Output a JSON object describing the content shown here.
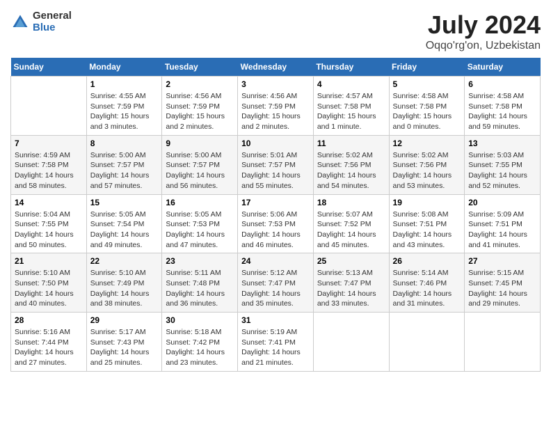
{
  "logo": {
    "general": "General",
    "blue": "Blue"
  },
  "title": "July 2024",
  "location": "Oqqo'rg'on, Uzbekistan",
  "days_of_week": [
    "Sunday",
    "Monday",
    "Tuesday",
    "Wednesday",
    "Thursday",
    "Friday",
    "Saturday"
  ],
  "weeks": [
    [
      {
        "day": "",
        "info": ""
      },
      {
        "day": "1",
        "sunrise": "Sunrise: 4:55 AM",
        "sunset": "Sunset: 7:59 PM",
        "daylight": "Daylight: 15 hours and 3 minutes."
      },
      {
        "day": "2",
        "sunrise": "Sunrise: 4:56 AM",
        "sunset": "Sunset: 7:59 PM",
        "daylight": "Daylight: 15 hours and 2 minutes."
      },
      {
        "day": "3",
        "sunrise": "Sunrise: 4:56 AM",
        "sunset": "Sunset: 7:59 PM",
        "daylight": "Daylight: 15 hours and 2 minutes."
      },
      {
        "day": "4",
        "sunrise": "Sunrise: 4:57 AM",
        "sunset": "Sunset: 7:58 PM",
        "daylight": "Daylight: 15 hours and 1 minute."
      },
      {
        "day": "5",
        "sunrise": "Sunrise: 4:58 AM",
        "sunset": "Sunset: 7:58 PM",
        "daylight": "Daylight: 15 hours and 0 minutes."
      },
      {
        "day": "6",
        "sunrise": "Sunrise: 4:58 AM",
        "sunset": "Sunset: 7:58 PM",
        "daylight": "Daylight: 14 hours and 59 minutes."
      }
    ],
    [
      {
        "day": "7",
        "sunrise": "Sunrise: 4:59 AM",
        "sunset": "Sunset: 7:58 PM",
        "daylight": "Daylight: 14 hours and 58 minutes."
      },
      {
        "day": "8",
        "sunrise": "Sunrise: 5:00 AM",
        "sunset": "Sunset: 7:57 PM",
        "daylight": "Daylight: 14 hours and 57 minutes."
      },
      {
        "day": "9",
        "sunrise": "Sunrise: 5:00 AM",
        "sunset": "Sunset: 7:57 PM",
        "daylight": "Daylight: 14 hours and 56 minutes."
      },
      {
        "day": "10",
        "sunrise": "Sunrise: 5:01 AM",
        "sunset": "Sunset: 7:57 PM",
        "daylight": "Daylight: 14 hours and 55 minutes."
      },
      {
        "day": "11",
        "sunrise": "Sunrise: 5:02 AM",
        "sunset": "Sunset: 7:56 PM",
        "daylight": "Daylight: 14 hours and 54 minutes."
      },
      {
        "day": "12",
        "sunrise": "Sunrise: 5:02 AM",
        "sunset": "Sunset: 7:56 PM",
        "daylight": "Daylight: 14 hours and 53 minutes."
      },
      {
        "day": "13",
        "sunrise": "Sunrise: 5:03 AM",
        "sunset": "Sunset: 7:55 PM",
        "daylight": "Daylight: 14 hours and 52 minutes."
      }
    ],
    [
      {
        "day": "14",
        "sunrise": "Sunrise: 5:04 AM",
        "sunset": "Sunset: 7:55 PM",
        "daylight": "Daylight: 14 hours and 50 minutes."
      },
      {
        "day": "15",
        "sunrise": "Sunrise: 5:05 AM",
        "sunset": "Sunset: 7:54 PM",
        "daylight": "Daylight: 14 hours and 49 minutes."
      },
      {
        "day": "16",
        "sunrise": "Sunrise: 5:05 AM",
        "sunset": "Sunset: 7:53 PM",
        "daylight": "Daylight: 14 hours and 47 minutes."
      },
      {
        "day": "17",
        "sunrise": "Sunrise: 5:06 AM",
        "sunset": "Sunset: 7:53 PM",
        "daylight": "Daylight: 14 hours and 46 minutes."
      },
      {
        "day": "18",
        "sunrise": "Sunrise: 5:07 AM",
        "sunset": "Sunset: 7:52 PM",
        "daylight": "Daylight: 14 hours and 45 minutes."
      },
      {
        "day": "19",
        "sunrise": "Sunrise: 5:08 AM",
        "sunset": "Sunset: 7:51 PM",
        "daylight": "Daylight: 14 hours and 43 minutes."
      },
      {
        "day": "20",
        "sunrise": "Sunrise: 5:09 AM",
        "sunset": "Sunset: 7:51 PM",
        "daylight": "Daylight: 14 hours and 41 minutes."
      }
    ],
    [
      {
        "day": "21",
        "sunrise": "Sunrise: 5:10 AM",
        "sunset": "Sunset: 7:50 PM",
        "daylight": "Daylight: 14 hours and 40 minutes."
      },
      {
        "day": "22",
        "sunrise": "Sunrise: 5:10 AM",
        "sunset": "Sunset: 7:49 PM",
        "daylight": "Daylight: 14 hours and 38 minutes."
      },
      {
        "day": "23",
        "sunrise": "Sunrise: 5:11 AM",
        "sunset": "Sunset: 7:48 PM",
        "daylight": "Daylight: 14 hours and 36 minutes."
      },
      {
        "day": "24",
        "sunrise": "Sunrise: 5:12 AM",
        "sunset": "Sunset: 7:47 PM",
        "daylight": "Daylight: 14 hours and 35 minutes."
      },
      {
        "day": "25",
        "sunrise": "Sunrise: 5:13 AM",
        "sunset": "Sunset: 7:47 PM",
        "daylight": "Daylight: 14 hours and 33 minutes."
      },
      {
        "day": "26",
        "sunrise": "Sunrise: 5:14 AM",
        "sunset": "Sunset: 7:46 PM",
        "daylight": "Daylight: 14 hours and 31 minutes."
      },
      {
        "day": "27",
        "sunrise": "Sunrise: 5:15 AM",
        "sunset": "Sunset: 7:45 PM",
        "daylight": "Daylight: 14 hours and 29 minutes."
      }
    ],
    [
      {
        "day": "28",
        "sunrise": "Sunrise: 5:16 AM",
        "sunset": "Sunset: 7:44 PM",
        "daylight": "Daylight: 14 hours and 27 minutes."
      },
      {
        "day": "29",
        "sunrise": "Sunrise: 5:17 AM",
        "sunset": "Sunset: 7:43 PM",
        "daylight": "Daylight: 14 hours and 25 minutes."
      },
      {
        "day": "30",
        "sunrise": "Sunrise: 5:18 AM",
        "sunset": "Sunset: 7:42 PM",
        "daylight": "Daylight: 14 hours and 23 minutes."
      },
      {
        "day": "31",
        "sunrise": "Sunrise: 5:19 AM",
        "sunset": "Sunset: 7:41 PM",
        "daylight": "Daylight: 14 hours and 21 minutes."
      },
      {
        "day": "",
        "info": ""
      },
      {
        "day": "",
        "info": ""
      },
      {
        "day": "",
        "info": ""
      }
    ]
  ]
}
